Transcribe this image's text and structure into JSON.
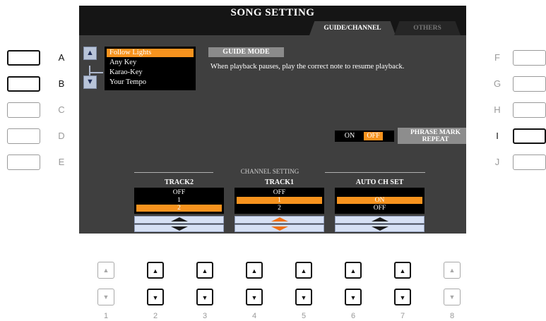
{
  "screen": {
    "title": "SONG SETTING",
    "tabs": [
      {
        "label": "GUIDE/CHANNEL",
        "active": true
      },
      {
        "label": "OTHERS",
        "active": false
      }
    ],
    "guide_list": {
      "items": [
        "Follow Lights",
        "Any Key",
        "Karao-Key",
        "Your Tempo"
      ],
      "selected": "Follow Lights",
      "up_arrow": "▲",
      "down_arrow": "▼"
    },
    "guide_mode": {
      "label": "GUIDE MODE",
      "description": "When playback pauses, play the correct note to resume playback."
    },
    "phrase_mark": {
      "on_label": "ON",
      "off_label": "OFF",
      "value": "OFF",
      "button_label_1": "PHRASE MARK",
      "button_label_2": "REPEAT"
    },
    "channel_setting": {
      "label": "CHANNEL SETTING",
      "columns": [
        {
          "header": "TRACK2",
          "options": [
            "OFF",
            "1",
            "2"
          ],
          "selected": "2"
        },
        {
          "header": "TRACK1",
          "options": [
            "OFF",
            "1",
            "2"
          ],
          "selected": "1"
        },
        {
          "header": "AUTO CH SET",
          "options": [
            "ON",
            "OFF"
          ],
          "selected": "ON"
        }
      ]
    }
  },
  "side_buttons": {
    "left": [
      {
        "letter": "A",
        "active": true
      },
      {
        "letter": "B",
        "active": true
      },
      {
        "letter": "C",
        "active": false
      },
      {
        "letter": "D",
        "active": false
      },
      {
        "letter": "E",
        "active": false
      }
    ],
    "right": [
      {
        "letter": "F",
        "active": false
      },
      {
        "letter": "G",
        "active": false
      },
      {
        "letter": "H",
        "active": false
      },
      {
        "letter": "I",
        "active": true
      },
      {
        "letter": "J",
        "active": false
      }
    ]
  },
  "bottom_buttons": {
    "numbers": [
      "1",
      "2",
      "3",
      "4",
      "5",
      "6",
      "7",
      "8"
    ],
    "active": [
      false,
      true,
      true,
      true,
      true,
      true,
      true,
      false
    ],
    "up_glyph": "▲",
    "down_glyph": "▼"
  },
  "colors": {
    "screen_bg": "#3f3f3f",
    "title_bg": "#151515",
    "highlight": "#f7931e",
    "arrow_button": "#d6e0f4"
  }
}
